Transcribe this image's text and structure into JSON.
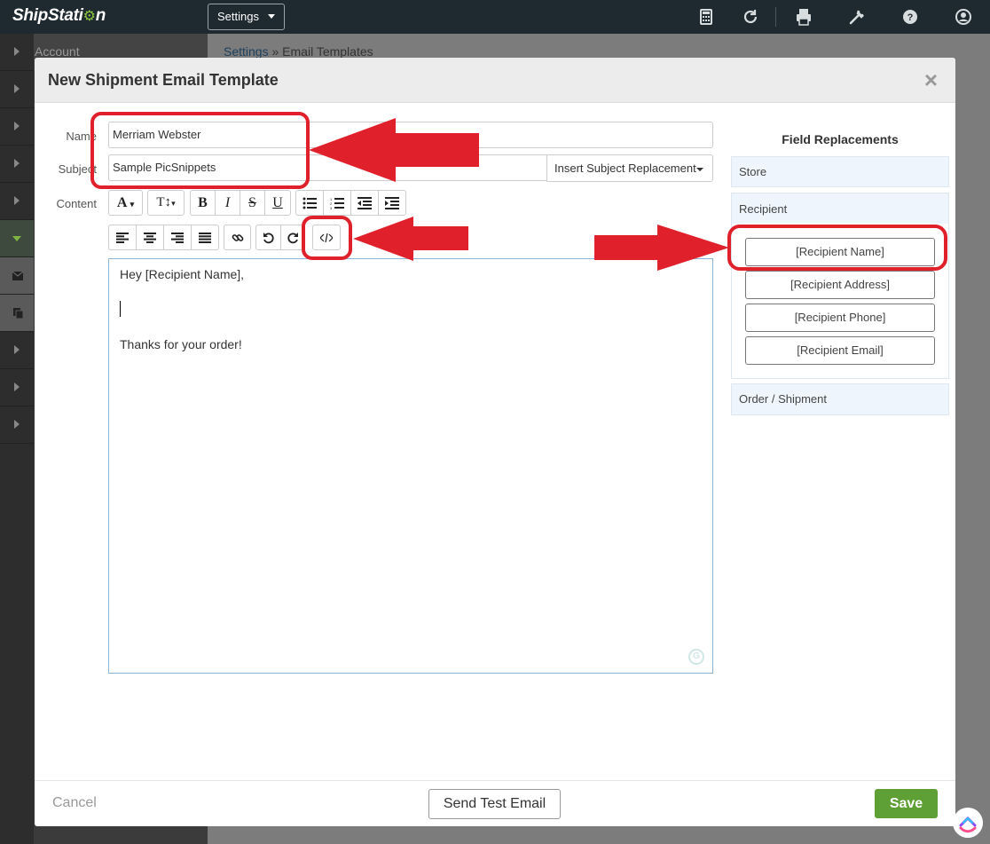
{
  "app": {
    "logo_text": "ShipStati",
    "logo_tail": "n"
  },
  "topbar": {
    "settings_label": "Settings"
  },
  "background": {
    "sidebar_account": "Account",
    "breadcrumb_link": "Settings",
    "breadcrumb_sep": " » ",
    "breadcrumb_current": "Email Templates"
  },
  "modal": {
    "title": "New Shipment Email Template",
    "close_glyph": "×",
    "name_label": "Name",
    "name_value": "Merriam Webster",
    "subject_label": "Subject",
    "subject_value": "Sample PicSnippets",
    "subject_replacement_label": "Insert Subject Replacement",
    "content_label": "Content",
    "toolbar": {
      "font_label": "A",
      "size_label": "T↕",
      "bold": "B",
      "italic": "I",
      "strike": "S",
      "underline": "U"
    },
    "editor_lines": [
      "Hey [Recipient Name],",
      "",
      "Thanks for your order!"
    ],
    "field_replacements": {
      "title": "Field Replacements",
      "store": "Store",
      "recipient": "Recipient",
      "recipient_fields": [
        "[Recipient Name]",
        "[Recipient Address]",
        "[Recipient Phone]",
        "[Recipient Email]"
      ],
      "order_shipment": "Order / Shipment"
    },
    "footer": {
      "cancel": "Cancel",
      "send_test": "Send Test Email",
      "save": "Save"
    }
  },
  "colors": {
    "topbar_bg": "#1f2a30",
    "accent_green": "#5fa036",
    "annotation_red": "#e0202a",
    "panel_blue": "#eef5fc"
  },
  "icons": [
    "calculator-icon",
    "refresh-icon",
    "printer-icon",
    "wrench-icon",
    "help-icon",
    "user-icon",
    "envelope-icon",
    "copy-icon",
    "source-code-icon",
    "link-icon",
    "undo-icon",
    "redo-icon"
  ]
}
